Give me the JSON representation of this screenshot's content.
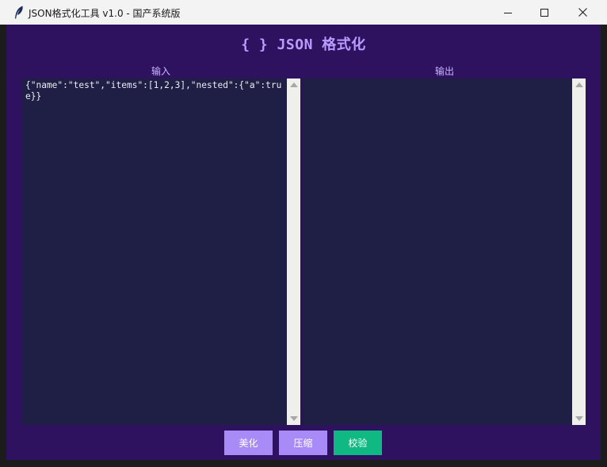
{
  "window": {
    "title": "JSON格式化工具  v1.0  -  国产系统版"
  },
  "app": {
    "title": "{ } JSON 格式化",
    "input_label": "输入",
    "output_label": "输出",
    "input_text": "{\"name\":\"test\",\"items\":[1,2,3],\"nested\":{\"a\":true}}",
    "output_text": ""
  },
  "buttons": {
    "beautify": "美化",
    "compress": "压缩",
    "validate": "校验"
  },
  "icons": [
    "feather-icon",
    "minimize-icon",
    "maximize-icon",
    "close-icon",
    "scroll-up-arrow-icon",
    "scroll-down-arrow-icon"
  ],
  "colors": {
    "background": "#2f125f",
    "panel": "#1f1e45",
    "accent": "#b89cff",
    "button_primary": "#a98bf7",
    "button_validate": "#10b981"
  }
}
